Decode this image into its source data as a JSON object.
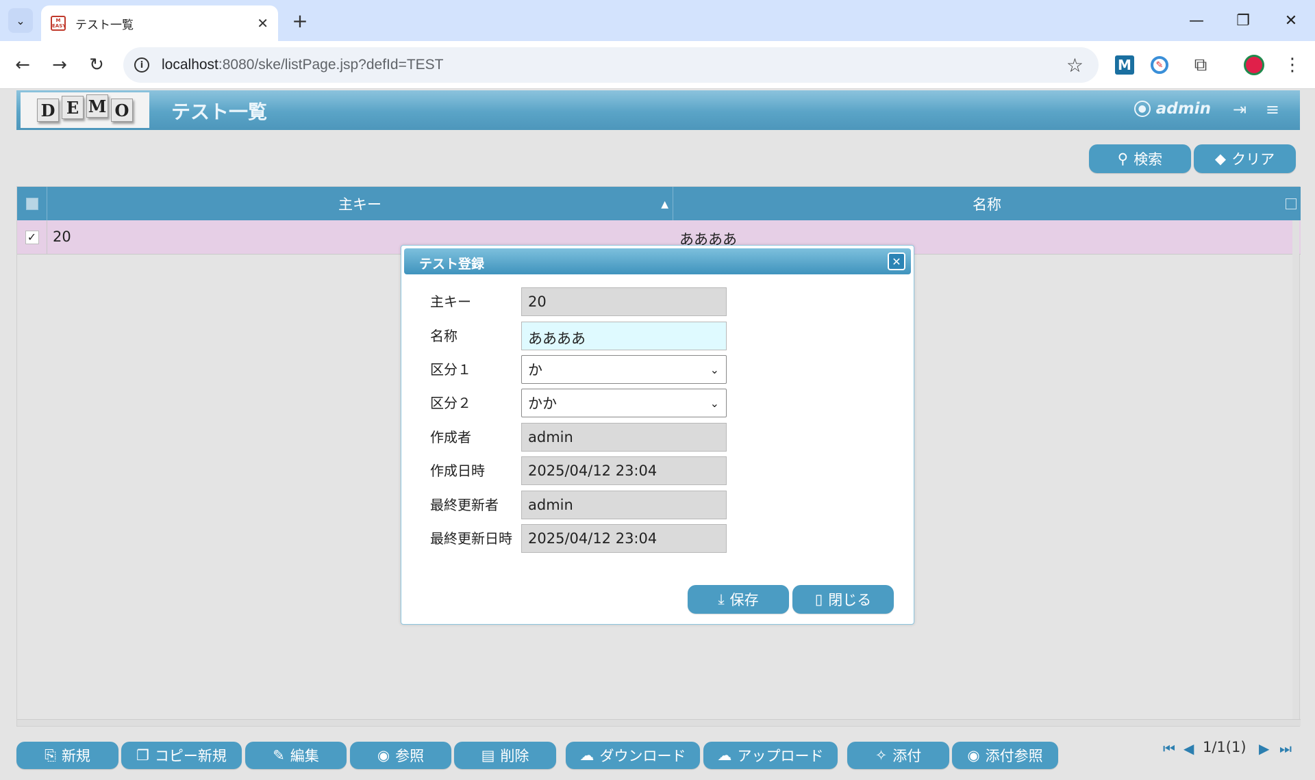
{
  "browser": {
    "tab_title": "テスト一覧",
    "favicon_text": "EASY",
    "url_host": "localhost",
    "url_rest": ":8080/ske/listPage.jsp?defId=TEST"
  },
  "header": {
    "logo_letters": [
      "D",
      "E",
      "M",
      "O"
    ],
    "title": "テスト一覧",
    "user": "admin"
  },
  "search_buttons": {
    "search": "検索",
    "clear": "クリア"
  },
  "grid": {
    "columns": [
      "主キー",
      "名称"
    ],
    "rows": [
      {
        "key": "20",
        "name": "ああああ",
        "checked": true
      }
    ]
  },
  "dialog": {
    "title": "テスト登録",
    "fields": [
      {
        "label": "主キー",
        "value": "20"
      },
      {
        "label": "名称",
        "value": "ああああ"
      },
      {
        "label": "区分１",
        "value": "か"
      },
      {
        "label": "区分２",
        "value": "かか"
      },
      {
        "label": "作成者",
        "value": "admin"
      },
      {
        "label": "作成日時",
        "value": "2025/04/12 23:04"
      },
      {
        "label": "最終更新者",
        "value": "admin"
      },
      {
        "label": "最終更新日時",
        "value": "2025/04/12 23:04"
      }
    ],
    "save": "保存",
    "close": "閉じる"
  },
  "actions": [
    "新規",
    "コピー新規",
    "編集",
    "参照",
    "削除",
    "ダウンロード",
    "アップロード",
    "添付",
    "添付参照"
  ],
  "pager": {
    "text": "1/1(1)"
  },
  "colors": {
    "header_blue": "#4b97be",
    "button_blue": "#4b9cc3",
    "selected_row": "#e6cfe6",
    "editable_field": "#dffaff"
  },
  "icons": [
    "search-icon",
    "eraser-icon",
    "user-icon",
    "logout-icon",
    "menu-icon",
    "close-icon",
    "save-icon",
    "door-icon"
  ]
}
